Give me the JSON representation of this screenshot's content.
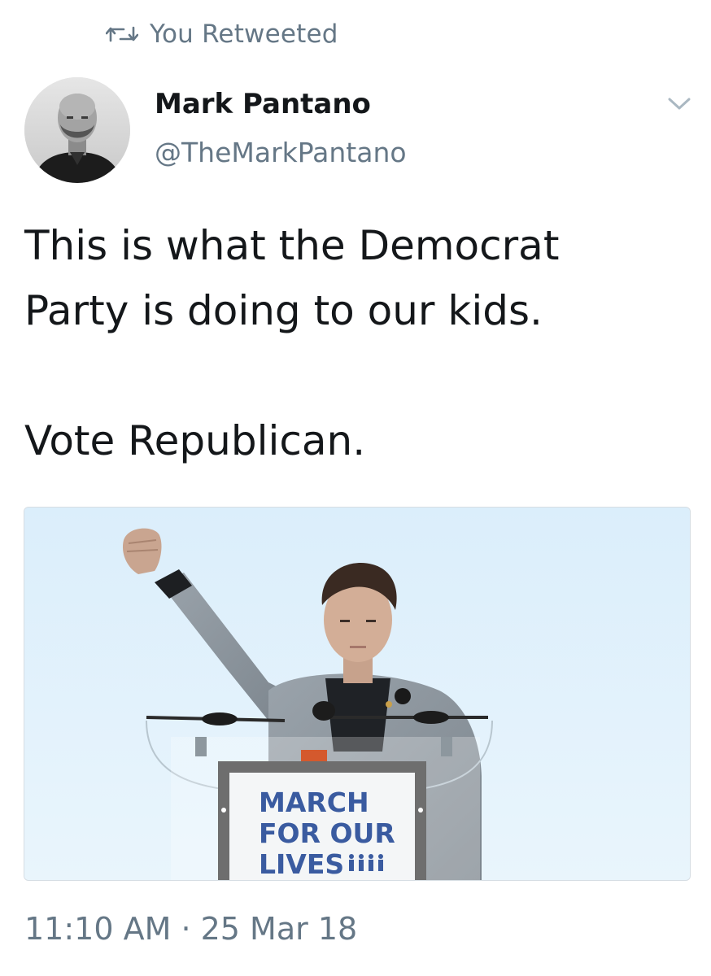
{
  "retweet": {
    "icon": "retweet-icon",
    "label": "You Retweeted"
  },
  "author": {
    "display_name": "Mark Pantano",
    "handle": "@TheMarkPantano",
    "avatar_icon": "avatar"
  },
  "tweet": {
    "line1": "This is what the Democrat",
    "line2": "Party is doing to our kids.",
    "line3": "Vote Republican."
  },
  "media": {
    "sign_line1": "MARCH",
    "sign_line2": "FOR OUR",
    "sign_line3": "LIVES"
  },
  "timestamp": "11:10 AM · 25 Mar 18",
  "colors": {
    "secondary_text": "#657786",
    "primary_text": "#14171a",
    "sky": "#e3f1fb",
    "sign_blue": "#3a5ba0"
  }
}
